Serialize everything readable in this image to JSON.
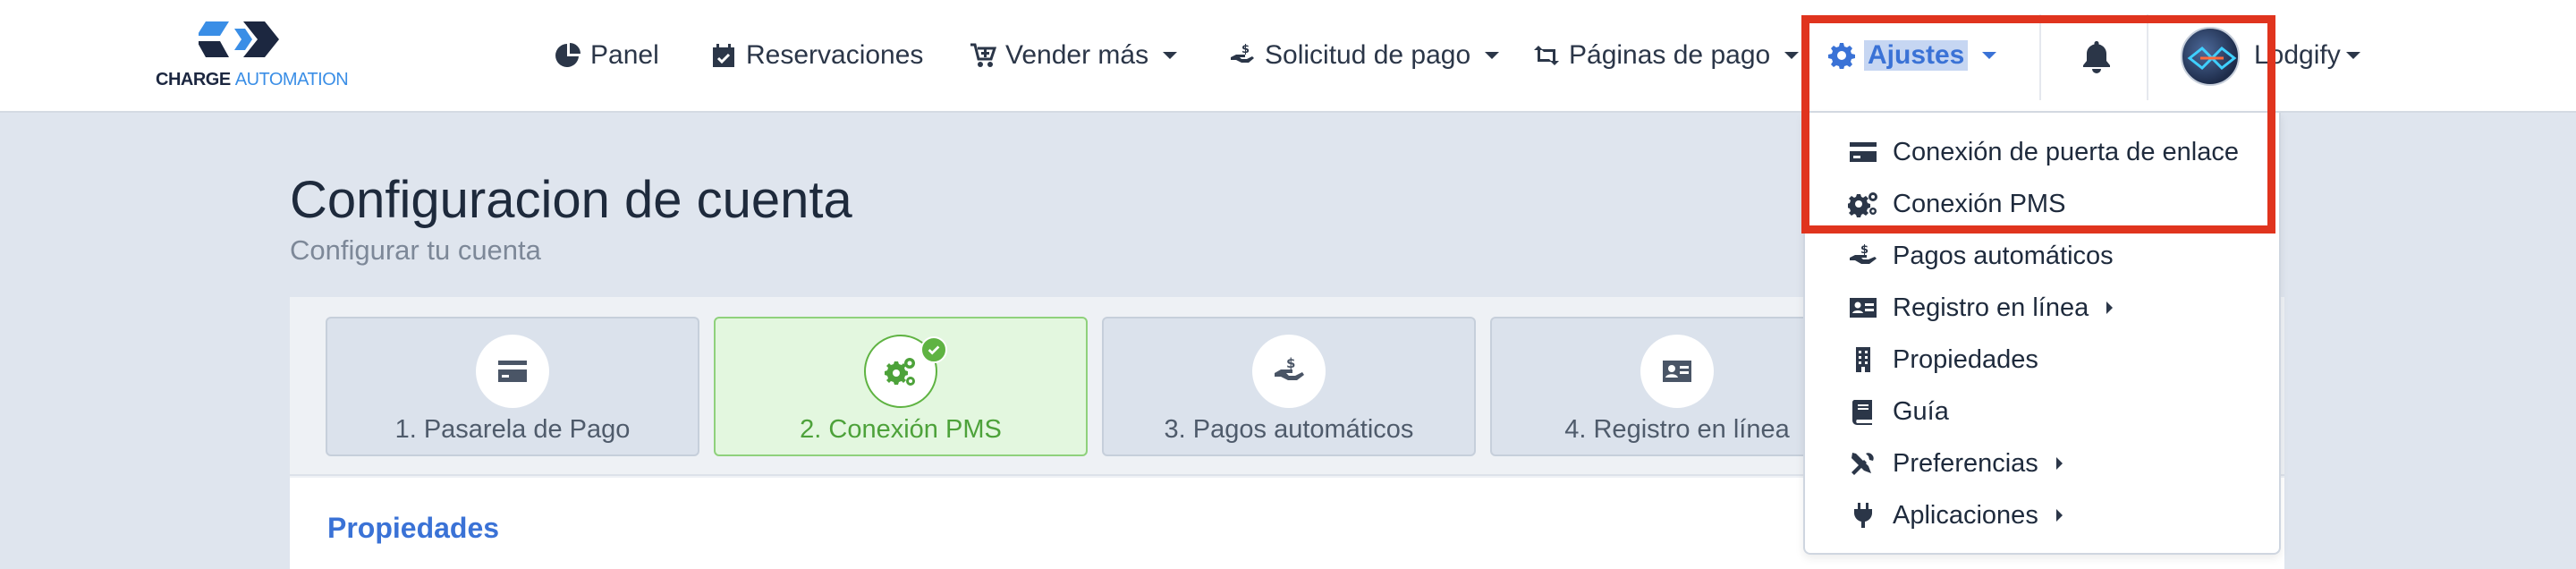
{
  "logo": {
    "text_part1": "CHARGE",
    "text_part2": "AUTOMATION",
    "brand_dark": "#1c2740",
    "brand_blue": "#3a8ee6"
  },
  "nav": {
    "panel": "Panel",
    "reservaciones": "Reservaciones",
    "vender_mas": "Vender más",
    "solicitud_pago": "Solicitud de pago",
    "paginas_pago": "Páginas de pago",
    "ajustes": "Ajustes",
    "user": "Lodgify"
  },
  "dropdown": {
    "items": [
      {
        "label": "Conexión de puerta de enlace",
        "icon": "credit-card-icon",
        "submenu": false
      },
      {
        "label": "Conexión PMS",
        "icon": "gears-icon",
        "submenu": false
      },
      {
        "label": "Pagos automáticos",
        "icon": "hand-dollar-icon",
        "submenu": false
      },
      {
        "label": "Registro en línea",
        "icon": "id-card-icon",
        "submenu": true
      },
      {
        "label": "Propiedades",
        "icon": "building-icon",
        "submenu": false
      },
      {
        "label": "Guía",
        "icon": "book-icon",
        "submenu": false
      },
      {
        "label": "Preferencias",
        "icon": "tools-icon",
        "submenu": true
      },
      {
        "label": "Aplicaciones",
        "icon": "plug-icon",
        "submenu": true
      }
    ]
  },
  "page": {
    "title": "Configuracion de cuenta",
    "subtitle": "Configurar tu cuenta",
    "section_title": "Propiedades"
  },
  "steps": [
    {
      "label": "1. Pasarela de Pago",
      "icon": "credit-card-icon",
      "state": "default"
    },
    {
      "label": "2. Conexión PMS",
      "icon": "gears-icon",
      "state": "completed"
    },
    {
      "label": "3. Pagos automáticos",
      "icon": "hand-dollar-icon",
      "state": "default"
    },
    {
      "label": "4. Registro en línea",
      "icon": "id-card-icon",
      "state": "default"
    }
  ],
  "colors": {
    "accent": "#3a72d6",
    "success": "#4da23a",
    "highlight_box": "#e0341e"
  }
}
